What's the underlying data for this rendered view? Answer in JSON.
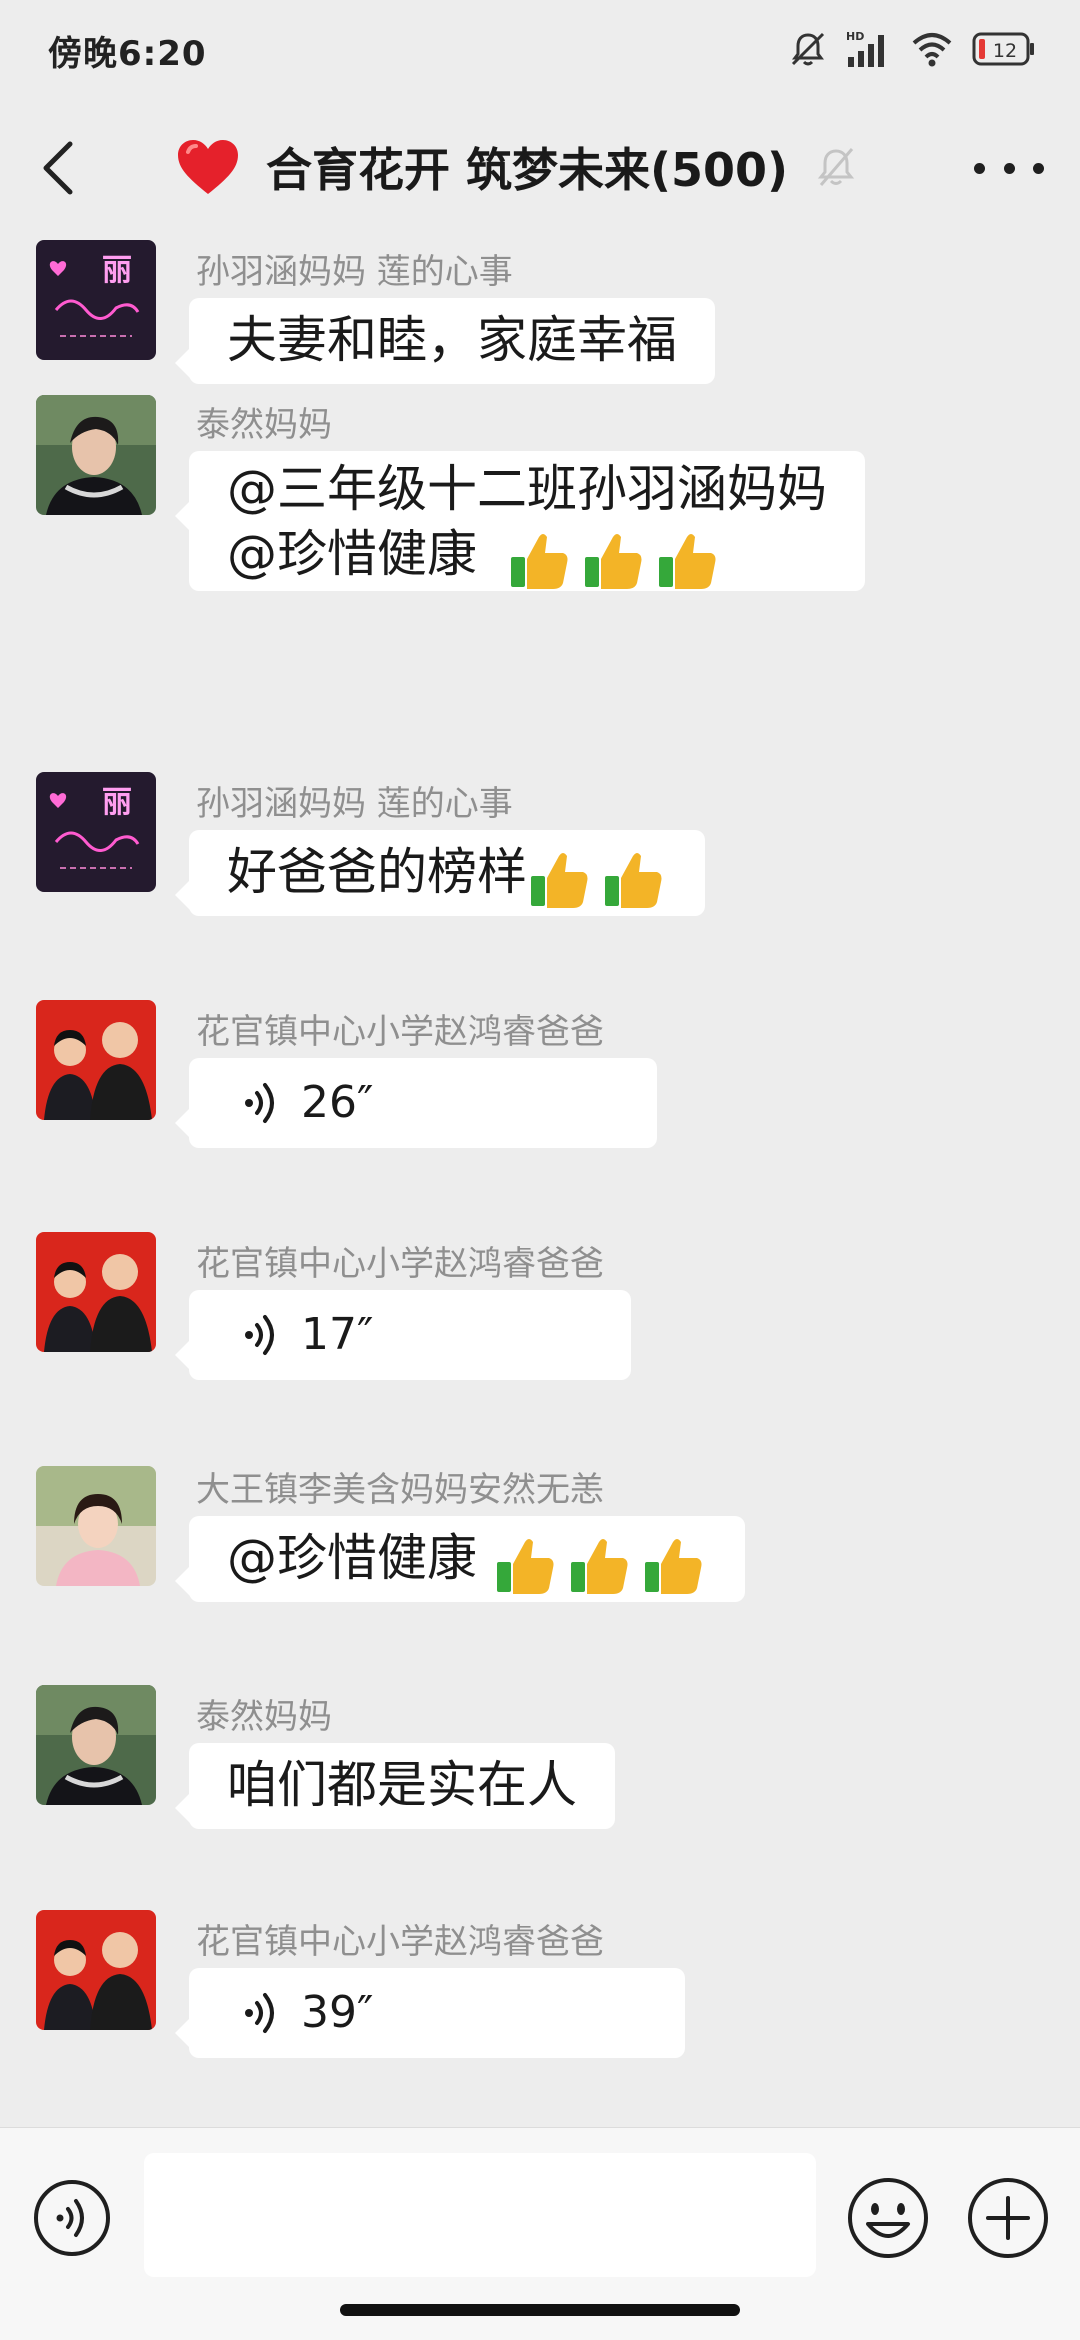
{
  "status_bar": {
    "time": "傍晚6:20",
    "network_label": "HD",
    "battery_level": "12"
  },
  "header": {
    "title": "合育花开 筑梦未来(500)",
    "title_emoji": "heart-icon",
    "muted": true
  },
  "messages": [
    {
      "sender": "孙羽涵妈妈  莲的心事",
      "type": "text",
      "lines": [
        "夫妻和睦，家庭幸福"
      ],
      "thumbs": 0
    },
    {
      "sender": "泰然妈妈",
      "type": "text",
      "lines": [
        "@三年级十二班孙羽涵妈妈",
        " @珍惜健康 "
      ],
      "thumbs": 3
    },
    {
      "sender": "孙羽涵妈妈  莲的心事",
      "type": "text",
      "lines": [
        "好爸爸的榜样"
      ],
      "thumbs": 2
    },
    {
      "sender": "花官镇中心小学赵鸿睿爸爸",
      "type": "voice",
      "duration": "26″"
    },
    {
      "sender": "花官镇中心小学赵鸿睿爸爸",
      "type": "voice",
      "duration": "17″"
    },
    {
      "sender": "大王镇李美含妈妈安然无恙",
      "type": "text",
      "lines": [
        "@珍惜健康 "
      ],
      "thumbs": 3
    },
    {
      "sender": "泰然妈妈",
      "type": "text",
      "lines": [
        "咱们都是实在人"
      ],
      "thumbs": 0
    },
    {
      "sender": "花官镇中心小学赵鸿睿爸爸",
      "type": "voice",
      "duration": "39″"
    }
  ],
  "input_bar": {
    "placeholder": ""
  },
  "colors": {
    "background": "#ededed",
    "bubble": "#ffffff",
    "sender_text": "#8f8f8f",
    "heart": "#e5212b",
    "battery_low": "#e53935"
  }
}
